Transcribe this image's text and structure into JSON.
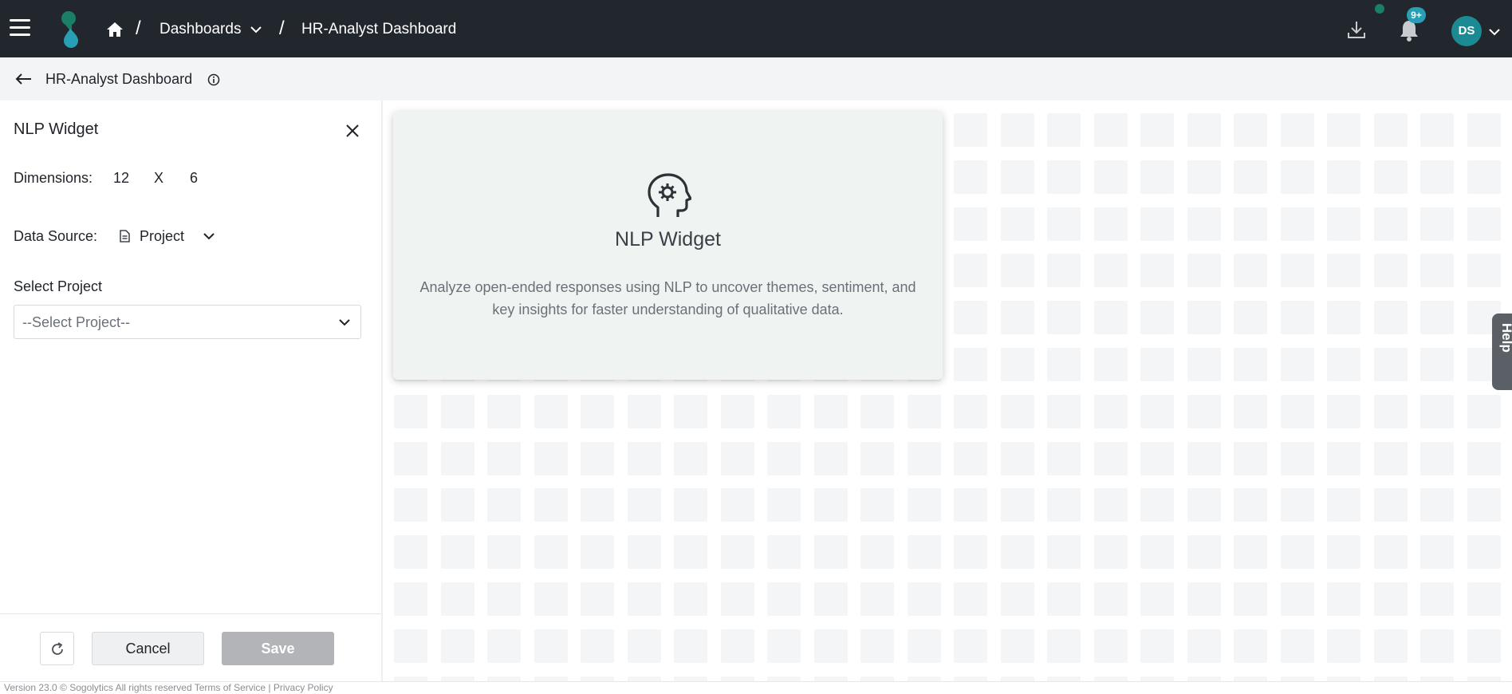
{
  "topbar": {
    "breadcrumb": {
      "separator": "/",
      "dashboards": "Dashboards",
      "current": "HR-Analyst Dashboard"
    },
    "notifications_badge": "9+",
    "avatar_initials": "DS",
    "icons": [
      "menu-icon",
      "logo",
      "home-icon",
      "chevron-down-icon",
      "download-icon",
      "bell-icon"
    ],
    "colors": {
      "bar": "#22262d",
      "avatar": "#1b8a93",
      "badge": "#27a0b5",
      "status_dot": "#1a7f64"
    }
  },
  "subheader": {
    "title": "HR-Analyst Dashboard"
  },
  "panel": {
    "title": "NLP Widget",
    "dimensions_label": "Dimensions:",
    "width": "12",
    "times": "X",
    "height": "6",
    "data_source_label": "Data Source:",
    "data_source_value": "Project",
    "select_project_label": "Select Project",
    "select_project_placeholder": "--Select Project--",
    "cancel_label": "Cancel",
    "save_label": "Save"
  },
  "card": {
    "title": "NLP Widget",
    "description": "Analyze open-ended responses using NLP to uncover themes, sentiment, and key insights for faster understanding of qualitative data."
  },
  "help": {
    "label": "Help"
  },
  "footer": {
    "text": "Version 23.0 © Sogolytics    All rights reserved    Terms of Service | Privacy Policy"
  }
}
